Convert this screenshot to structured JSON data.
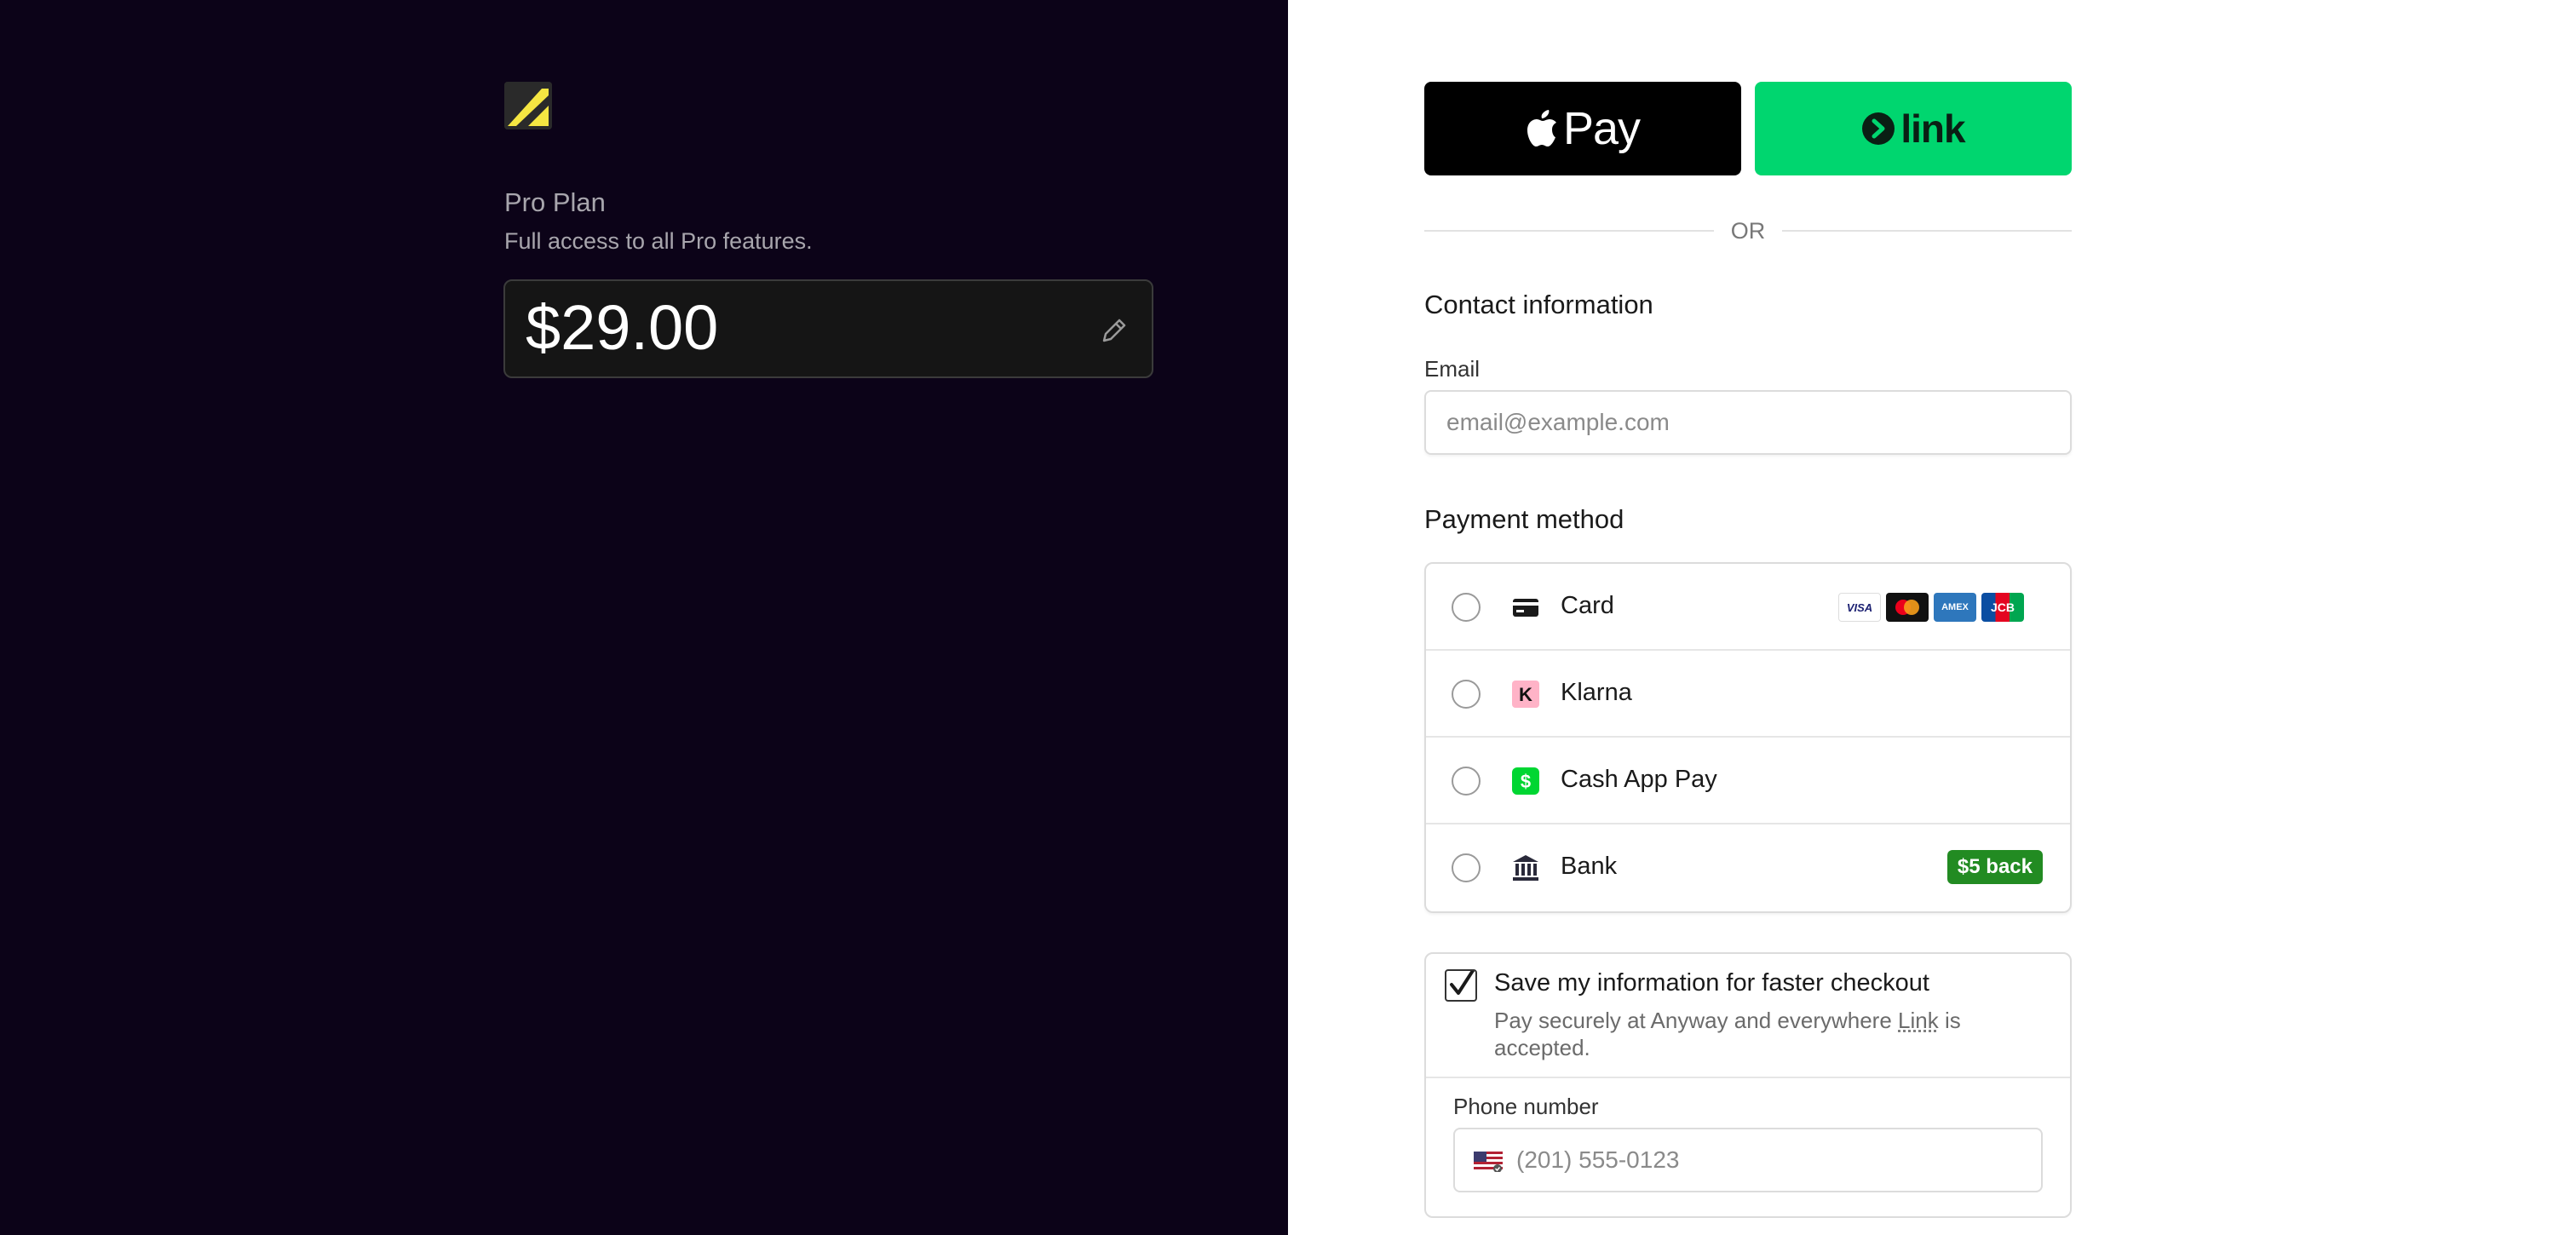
{
  "product": {
    "name": "Pro Plan",
    "description": "Full access to all Pro features.",
    "price": "$29.00"
  },
  "express": {
    "apple_pay_label": "Pay",
    "link_label": "link"
  },
  "divider_text": "OR",
  "contact": {
    "title": "Contact information",
    "email_label": "Email",
    "email_placeholder": "email@example.com"
  },
  "payment": {
    "title": "Payment method",
    "methods": [
      {
        "label": "Card",
        "icon": "card-icon"
      },
      {
        "label": "Klarna",
        "icon": "klarna-icon"
      },
      {
        "label": "Cash App Pay",
        "icon": "cash-app-icon"
      },
      {
        "label": "Bank",
        "icon": "bank-icon",
        "badge": "$5 back"
      }
    ],
    "card_brands": [
      "VISA",
      "Mastercard",
      "AMEX",
      "JCB"
    ]
  },
  "save_info": {
    "checked": true,
    "title": "Save my information for faster checkout",
    "subtitle_before": "Pay securely at Anyway and everywhere ",
    "subtitle_link": "Link",
    "subtitle_after": " is accepted.",
    "phone_label": "Phone number",
    "phone_placeholder": "(201) 555-0123"
  },
  "colors": {
    "left_bg": "#0c0318",
    "link_green": "#00d66f",
    "badge_green": "#228b22",
    "logo_yellow": "#f5e642"
  }
}
